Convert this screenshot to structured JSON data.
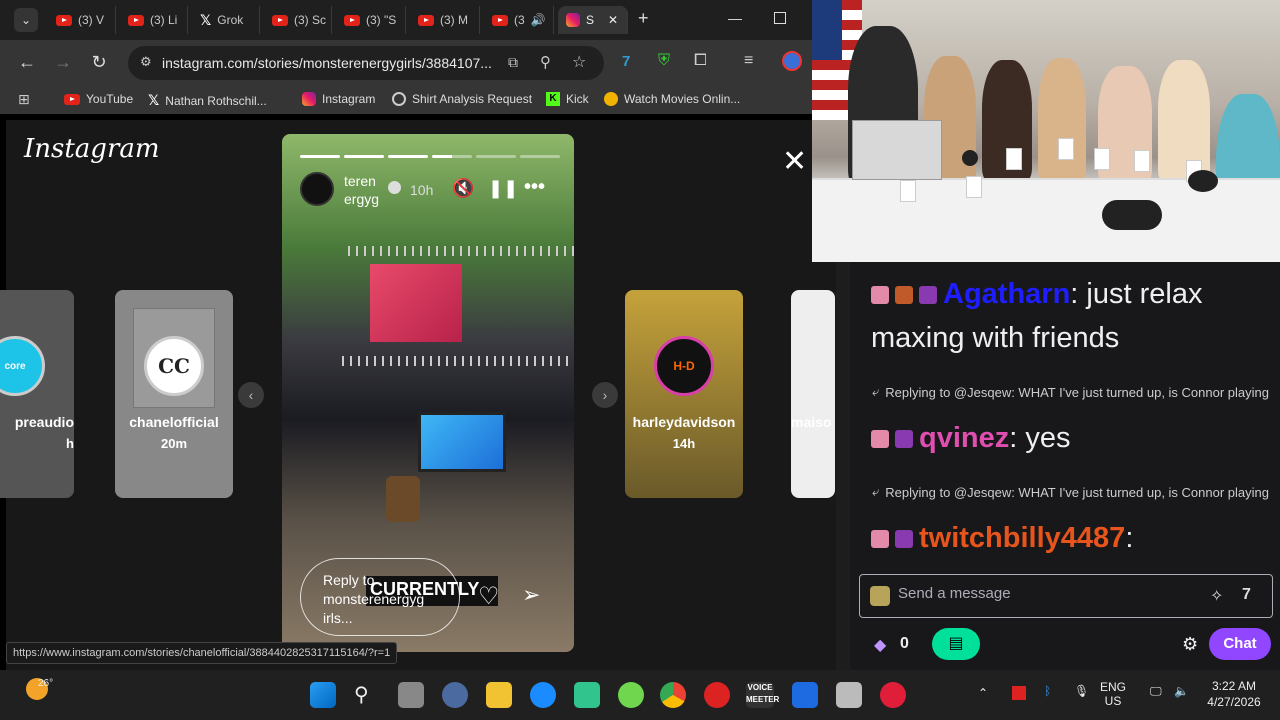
{
  "browser": {
    "tabs": [
      {
        "title": "(3) V",
        "icon": "youtube-icon"
      },
      {
        "title": "(3) Li",
        "icon": "youtube-icon"
      },
      {
        "title": "Grok",
        "icon": "x-icon"
      },
      {
        "title": "(3) Sc",
        "icon": "youtube-icon"
      },
      {
        "title": "(3) \"S",
        "icon": "youtube-icon"
      },
      {
        "title": "(3) M",
        "icon": "youtube-icon"
      },
      {
        "title": "(3",
        "icon": "youtube-icon"
      },
      {
        "title": "S",
        "icon": "instagram-icon"
      }
    ],
    "url": "instagram.com/stories/monsterenergygirls/3884107...",
    "bookmarks": [
      "YouTube",
      "Nathan Rothschil...",
      "Instagram",
      "Shirt Analysis Request",
      "Kick",
      "Watch Movies Onlin..."
    ]
  },
  "instagram": {
    "logo": "Instagram",
    "stories_left": [
      {
        "name": "preaudio",
        "time": "h",
        "avatar_text": "core"
      },
      {
        "name": "chanelofficial",
        "time": "20m",
        "avatar_text": "CC"
      }
    ],
    "stories_right": [
      {
        "name": "harleydavidson",
        "time": "14h",
        "avatar_text": "H-D"
      },
      {
        "name": "maiso",
        "time": "",
        "avatar_text": ""
      }
    ],
    "main_story": {
      "username_line1": "teren",
      "username_line2": "ergyg",
      "time": "10h",
      "reply_placeholder": "Reply to monsterenergyg irls...",
      "overlay_text": "CURRENTLY"
    },
    "status_url": "https://www.instagram.com/stories/chanelofficial/3884402825317115164/?r=1"
  },
  "chat": {
    "messages": [
      {
        "user": "Agatharn",
        "text": ": just relax maxing with friends",
        "color": "#1e1eff"
      },
      {
        "reply": "Replying to @Jesqew: WHAT I've just turned up, is Connor playing"
      },
      {
        "user": "qvinez",
        "text": ": yes",
        "color": "#e04fb0"
      },
      {
        "reply": "Replying to @Jesqew: WHAT I've just turned up, is Connor playing"
      },
      {
        "user": "twitchbilly4487",
        "text": ":",
        "color": "#e8551c"
      }
    ],
    "input_placeholder": "Send a message",
    "points": "0",
    "chat_button": "Chat"
  },
  "taskbar": {
    "weather": "26°",
    "lang1": "ENG",
    "lang2": "US",
    "time": "3:22 AM",
    "date": "4/27/2026",
    "voicemeeter": "VOICE MEETER"
  }
}
